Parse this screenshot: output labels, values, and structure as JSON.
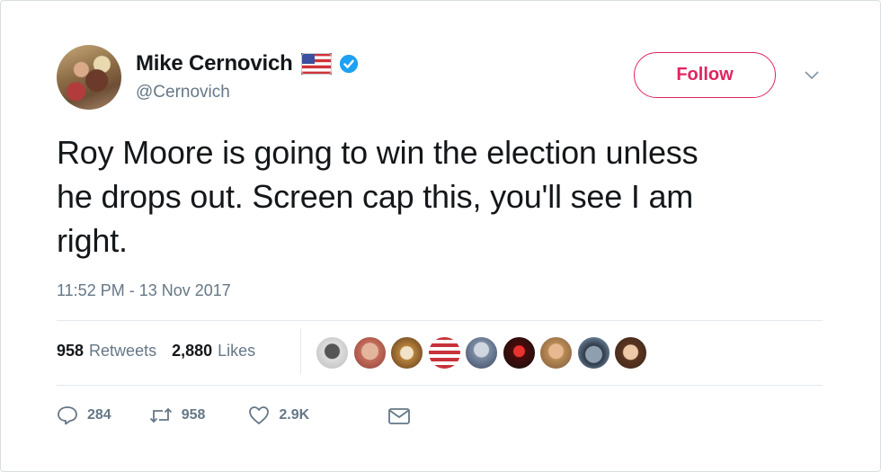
{
  "tweet": {
    "author": {
      "display_name": "Mike Cernovich",
      "handle": "@Cernovich",
      "flag_icon": "us-flag-icon",
      "verified_icon": "verified-badge-icon"
    },
    "follow_label": "Follow",
    "text": "Roy Moore is going to win the election unless\nhe drops out. Screen cap this, you'll see I am\nright.",
    "timestamp": "11:52 PM - 13 Nov 2017",
    "stats": {
      "retweets_count": "958",
      "retweets_label": "Retweets",
      "likes_count": "2,880",
      "likes_label": "Likes"
    },
    "likers_count_shown": 9,
    "actions": {
      "reply_count": "284",
      "retweet_count": "958",
      "like_count": "2.9K"
    }
  },
  "colors": {
    "follow_accent": "#e0245e",
    "secondary_text": "#657786",
    "verified_blue": "#1da1f2",
    "divider": "#e1e8ed"
  }
}
